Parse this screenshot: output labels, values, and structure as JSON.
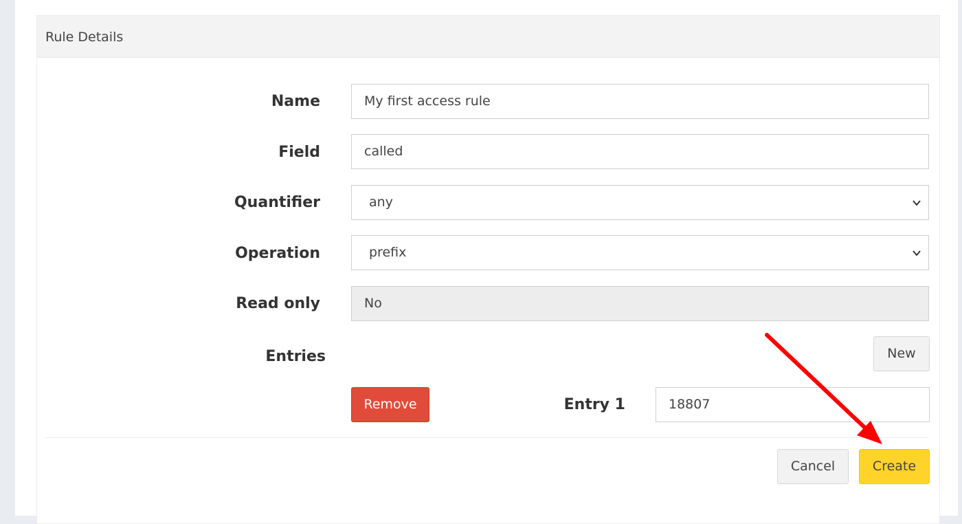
{
  "panel": {
    "title": "Rule Details"
  },
  "form": {
    "name": {
      "label": "Name",
      "value": "My first access rule"
    },
    "field": {
      "label": "Field",
      "value": "called"
    },
    "quantifier": {
      "label": "Quantifier",
      "value": "any"
    },
    "operation": {
      "label": "Operation",
      "value": "prefix"
    },
    "read_only": {
      "label": "Read only",
      "value": "No"
    },
    "entries": {
      "label": "Entries",
      "new_label": "New",
      "items": [
        {
          "label": "Entry 1",
          "value": "18807",
          "remove_label": "Remove"
        }
      ]
    }
  },
  "footer": {
    "cancel_label": "Cancel",
    "create_label": "Create"
  },
  "colors": {
    "create": "#ffd32a",
    "remove": "#e04b3a",
    "annotation_arrow": "#ff0000"
  },
  "icons": {
    "select_indicator": "chevron-down-icon"
  }
}
